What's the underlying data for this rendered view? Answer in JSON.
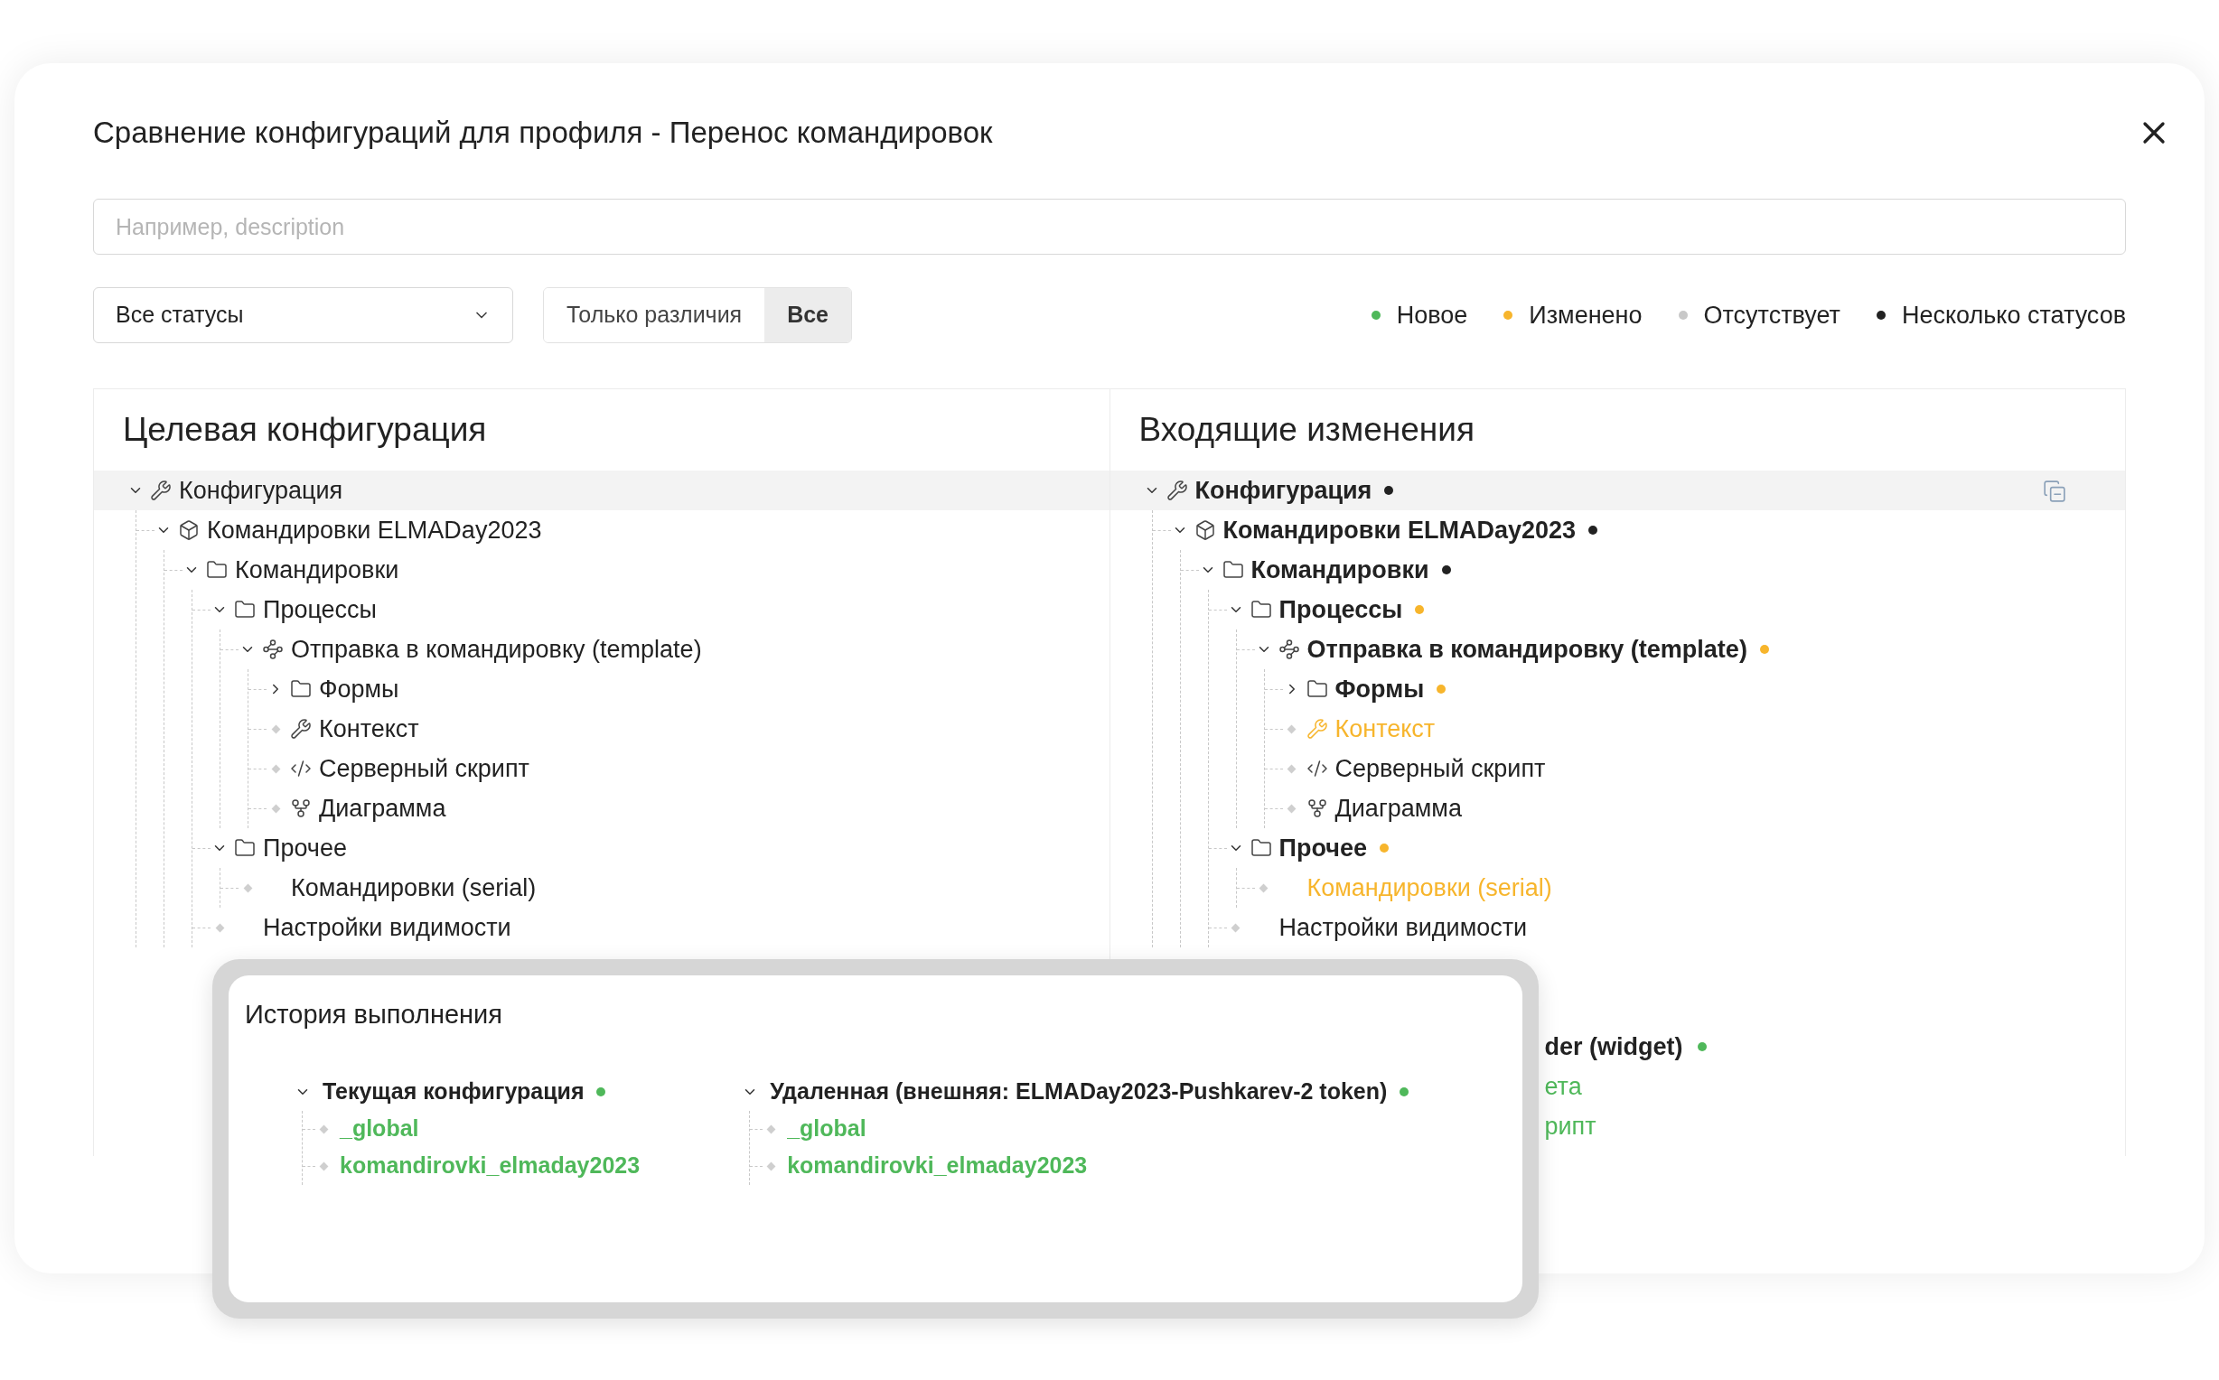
{
  "dialog": {
    "title": "Сравнение конфигураций для профиля - Перенос командировок"
  },
  "search": {
    "placeholder": "Например, description"
  },
  "status_filter": {
    "value": "Все статусы"
  },
  "view_toggle": [
    {
      "label": "Только различия",
      "selected": false
    },
    {
      "label": "Все",
      "selected": true
    }
  ],
  "legend": [
    {
      "label": "Новое",
      "color": "#4fb85a"
    },
    {
      "label": "Изменено",
      "color": "#f7b52c"
    },
    {
      "label": "Отсутствует",
      "color": "#c8c8c8"
    },
    {
      "label": "Несколько статусов",
      "color": "#222222"
    }
  ],
  "left_panel": {
    "title": "Целевая конфигурация",
    "tree": [
      {
        "label": "Конфигурация",
        "kind": "config",
        "expanded": true,
        "selected": true,
        "children": [
          {
            "label": "Командировки ELMADay2023",
            "kind": "app",
            "expanded": true,
            "selected": false,
            "children": [
              {
                "label": "Командировки",
                "kind": "folder",
                "expanded": true,
                "selected": false,
                "children": [
                  {
                    "label": "Процессы",
                    "kind": "folder",
                    "expanded": true,
                    "selected": false,
                    "children": [
                      {
                        "label": "Отправка в командировку (template)",
                        "kind": "process",
                        "expanded": true,
                        "selected": false,
                        "children": [
                          {
                            "label": "Формы",
                            "kind": "folder",
                            "expanded": false,
                            "selected": false
                          },
                          {
                            "label": "Контекст",
                            "kind": "context",
                            "selected": false
                          },
                          {
                            "label": "Серверный скрипт",
                            "kind": "script",
                            "selected": false
                          },
                          {
                            "label": "Диаграмма",
                            "kind": "diagram",
                            "selected": false
                          }
                        ]
                      }
                    ]
                  },
                  {
                    "label": "Прочее",
                    "kind": "folder",
                    "expanded": true,
                    "selected": false,
                    "children": [
                      {
                        "label": "Командировки (serial)",
                        "kind": "item",
                        "selected": false
                      }
                    ]
                  },
                  {
                    "label": "Настройки видимости",
                    "kind": "item",
                    "selected": false
                  }
                ]
              }
            ]
          }
        ]
      }
    ]
  },
  "right_panel": {
    "title": "Входящие изменения",
    "tree": [
      {
        "label": "Конфигурация",
        "kind": "config",
        "expanded": true,
        "selected": true,
        "color": "#222222",
        "children": [
          {
            "label": "Командировки ELMADay2023",
            "kind": "app",
            "expanded": true,
            "selected": false,
            "color": "#222222",
            "children": [
              {
                "label": "Командировки",
                "kind": "folder",
                "expanded": true,
                "selected": false,
                "color": "#222222",
                "children": [
                  {
                    "label": "Процессы",
                    "kind": "folder",
                    "expanded": true,
                    "selected": false,
                    "color": "#f7b52c",
                    "children": [
                      {
                        "label": "Отправка в командировку (template)",
                        "kind": "process",
                        "expanded": true,
                        "selected": false,
                        "color": "#f7b52c",
                        "children": [
                          {
                            "label": "Формы",
                            "kind": "folder",
                            "expanded": false,
                            "selected": false,
                            "color": "#f7b52c"
                          },
                          {
                            "label": "Контекст",
                            "kind": "context",
                            "selected": false,
                            "color": "#f7b52c"
                          },
                          {
                            "label": "Серверный скрипт",
                            "kind": "script",
                            "selected": false
                          },
                          {
                            "label": "Диаграмма",
                            "kind": "diagram",
                            "selected": false
                          }
                        ]
                      }
                    ]
                  },
                  {
                    "label": "Прочее",
                    "kind": "folder",
                    "expanded": true,
                    "selected": false,
                    "color": "#f7b52c",
                    "children": [
                      {
                        "label": "Командировки (serial)",
                        "kind": "item",
                        "selected": false,
                        "color": "#f7b52c"
                      }
                    ]
                  },
                  {
                    "label": "Настройки видимости",
                    "kind": "item",
                    "selected": false
                  }
                ]
              }
            ]
          }
        ]
      }
    ],
    "clipped_rows": [
      {
        "label": "der (widget)",
        "kind": "branch",
        "color": "#4fb85a"
      },
      {
        "label": "ета",
        "kind": "leaf",
        "color": "#4fb85a"
      },
      {
        "label": "рипт",
        "kind": "leaf",
        "color": "#4fb85a"
      }
    ]
  },
  "history_popup": {
    "title": "История выполнения",
    "columns": [
      {
        "label": "Текущая конфигурация",
        "expanded": true,
        "color": "#4fb85a",
        "children": [
          {
            "label": "_global",
            "color": "#4fb85a"
          },
          {
            "label": "komandirovki_elmaday2023",
            "color": "#4fb85a"
          }
        ]
      },
      {
        "label": "Удаленная (внешняя: ELMADay2023-Pushkarev-2 token)",
        "expanded": true,
        "color": "#4fb85a",
        "children": [
          {
            "label": "_global",
            "color": "#4fb85a"
          },
          {
            "label": "komandirovki_elmaday2023",
            "color": "#4fb85a"
          }
        ]
      }
    ]
  }
}
